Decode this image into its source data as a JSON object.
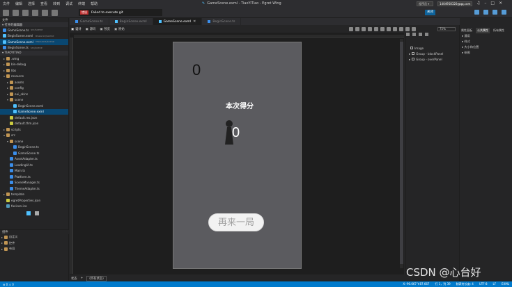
{
  "menu": [
    "文件",
    "编辑",
    "选择",
    "查看",
    "转到",
    "调试",
    "终端",
    "帮助"
  ],
  "window_title": "GameScene.exml - TiaoYiTiao - Egret Wing",
  "mode_select": "程序员 ▾",
  "account": "1404958320@qq.com",
  "toast": {
    "badge": "错误",
    "message": "Failed to execute git"
  },
  "close_button": "关闭",
  "explorer": {
    "open_editors_title": "▾ 打开的编辑器",
    "open_editors": [
      {
        "name": "GameScene.ts",
        "desc": "src/scene"
      },
      {
        "name": "BeginScene.exml",
        "desc": "resource/scene"
      },
      {
        "name": "GameScene.exml",
        "desc": "resource/scene"
      },
      {
        "name": "BeginScene.ts",
        "desc": "src/scene"
      }
    ],
    "project_title": "▾ TIAOYITIAO",
    "tree": [
      {
        "name": ".wing",
        "indent": 1,
        "type": "folder",
        "arrow": "▸"
      },
      {
        "name": "bin-debug",
        "indent": 1,
        "type": "folder",
        "arrow": "▸"
      },
      {
        "name": "libs",
        "indent": 1,
        "type": "folder",
        "arrow": "▸"
      },
      {
        "name": "resource",
        "indent": 1,
        "type": "folder",
        "arrow": "▾"
      },
      {
        "name": "assets",
        "indent": 2,
        "type": "folder",
        "arrow": "▸"
      },
      {
        "name": "config",
        "indent": 2,
        "type": "folder",
        "arrow": "▸"
      },
      {
        "name": "eui_skins",
        "indent": 2,
        "type": "folder",
        "arrow": "▸"
      },
      {
        "name": "scene",
        "indent": 2,
        "type": "folder",
        "arrow": "▾"
      },
      {
        "name": "BeginScene.exml",
        "indent": 3,
        "type": "exml",
        "arrow": ""
      },
      {
        "name": "GameScene.exml",
        "indent": 3,
        "type": "exml",
        "arrow": "",
        "selected": true
      },
      {
        "name": "default.res.json",
        "indent": 2,
        "type": "json",
        "arrow": ""
      },
      {
        "name": "default.thm.json",
        "indent": 2,
        "type": "json",
        "arrow": ""
      },
      {
        "name": "scripts",
        "indent": 1,
        "type": "folder",
        "arrow": "▸"
      },
      {
        "name": "src",
        "indent": 1,
        "type": "folder",
        "arrow": "▾"
      },
      {
        "name": "scene",
        "indent": 2,
        "type": "folder",
        "arrow": "▾"
      },
      {
        "name": "BeginScene.ts",
        "indent": 3,
        "type": "ts",
        "arrow": ""
      },
      {
        "name": "GameScene.ts",
        "indent": 3,
        "type": "ts",
        "arrow": ""
      },
      {
        "name": "AssetAdapter.ts",
        "indent": 2,
        "type": "ts",
        "arrow": ""
      },
      {
        "name": "LoadingUI.ts",
        "indent": 2,
        "type": "ts",
        "arrow": ""
      },
      {
        "name": "Main.ts",
        "indent": 2,
        "type": "ts",
        "arrow": ""
      },
      {
        "name": "Platform.ts",
        "indent": 2,
        "type": "ts",
        "arrow": ""
      },
      {
        "name": "SceneManager.ts",
        "indent": 2,
        "type": "ts",
        "arrow": ""
      },
      {
        "name": "ThemeAdapter.ts",
        "indent": 2,
        "type": "ts",
        "arrow": ""
      },
      {
        "name": "template",
        "indent": 1,
        "type": "folder",
        "arrow": "▸"
      },
      {
        "name": "egretProperties.json",
        "indent": 1,
        "type": "json",
        "arrow": ""
      },
      {
        "name": "favicon.ico",
        "indent": 1,
        "type": "css",
        "arrow": ""
      }
    ],
    "components_title": "组件",
    "components": [
      "自定义",
      "控件",
      "布局"
    ]
  },
  "editor_tabs": [
    {
      "label": "GameScene.ts",
      "active": false
    },
    {
      "label": "BeginScene.exml",
      "active": false
    },
    {
      "label": "GameScene.exml",
      "active": true
    },
    {
      "label": "BeginScene.ts",
      "active": false
    }
  ],
  "design_tabs": [
    {
      "label": "设计",
      "active": true
    },
    {
      "label": "源码",
      "active": false
    },
    {
      "label": "预览",
      "active": false
    },
    {
      "label": "原始",
      "active": false
    }
  ],
  "zoom": "75%",
  "stage": {
    "score": "0",
    "score_title": "本次得分",
    "final_score": "0",
    "retry_label": "再来一局"
  },
  "layers": [
    {
      "label": "Image",
      "arrow": ""
    },
    {
      "label": "Group - blockPanel",
      "arrow": "▸"
    },
    {
      "label": "Group - overPanel",
      "arrow": "▸"
    }
  ],
  "props_tabs": [
    {
      "label": "属性面板",
      "active": false
    },
    {
      "label": "公共属性",
      "active": true
    },
    {
      "label": "所有属性",
      "active": false
    }
  ],
  "props_rows": [
    "▸ 通用",
    "▸ 样式",
    "▸ 大小和位置",
    "▸ 绘图"
  ],
  "status_left": {
    "state": "状态",
    "add": "+",
    "all_states": "(所有状态)"
  },
  "statusbar": {
    "left": "⊗ 0 ⚠ 0",
    "coords": "X:-90.667 Y:87.667",
    "position": "行 1，列 39",
    "indent": "制表符长度: 4",
    "encoding": "UTF-8",
    "eol": "LF",
    "lang": "EXML"
  },
  "watermark": "CSDN @心台好"
}
